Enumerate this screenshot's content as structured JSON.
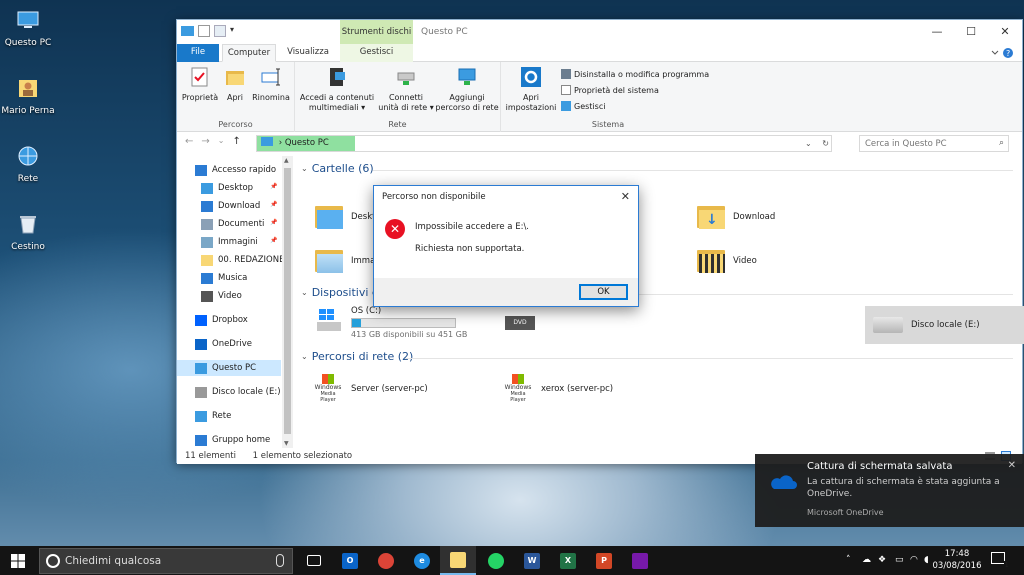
{
  "desktop": {
    "icons": [
      {
        "label": "Questo PC",
        "icon": "this-pc-icon"
      },
      {
        "label": "Mario Perna",
        "icon": "user-folder-icon"
      },
      {
        "label": "Rete",
        "icon": "network-icon"
      },
      {
        "label": "Cestino",
        "icon": "recycle-bin-icon"
      }
    ]
  },
  "explorer": {
    "title": "Questo PC",
    "context_tab_header": "Strumenti dischi",
    "tabs": {
      "file": "File",
      "computer": "Computer",
      "visualizza": "Visualizza",
      "gestisci": "Gestisci"
    },
    "ribbon": {
      "percorso": {
        "label": "Percorso",
        "buttons": [
          "Proprietà",
          "Apri",
          "Rinomina"
        ]
      },
      "rete": {
        "label": "Rete",
        "accedi": [
          "Accedi a contenuti",
          "multimediali ▾"
        ],
        "connetti": [
          "Connetti",
          "unità di rete ▾"
        ],
        "aggiungi": [
          "Aggiungi",
          "percorso di rete"
        ]
      },
      "sistema": {
        "label": "Sistema",
        "apri": [
          "Apri",
          "impostazioni"
        ],
        "small": [
          "Disinstalla o modifica programma",
          "Proprietà del sistema",
          "Gestisci"
        ]
      }
    },
    "address": {
      "crumb": "Questo PC",
      "separator": "›"
    },
    "search": {
      "placeholder": "Cerca in Questo PC"
    },
    "nav_glyphs": {
      "back": "←",
      "forward": "→",
      "dropdown": "⌄",
      "up": "↑"
    },
    "address_tools": {
      "dropdown": "⌄",
      "refresh": "↻"
    },
    "navpane": [
      {
        "label": "Accesso rapido",
        "icon": "star-icon",
        "color": "#2b7bd3"
      },
      {
        "label": "Desktop",
        "icon": "desktop-icon",
        "color": "#3b9be0",
        "pinned": true
      },
      {
        "label": "Download",
        "icon": "download-icon",
        "color": "#2b7bd3",
        "pinned": true
      },
      {
        "label": "Documenti",
        "icon": "documents-icon",
        "color": "#8aa0b6",
        "pinned": true
      },
      {
        "label": "Immagini",
        "icon": "pictures-icon",
        "color": "#7aa7c7",
        "pinned": true
      },
      {
        "label": "00. REDAZIONE",
        "icon": "folder-icon",
        "color": "#f8d775"
      },
      {
        "label": "Musica",
        "icon": "music-icon",
        "color": "#2b7bd3"
      },
      {
        "label": "Video",
        "icon": "video-icon",
        "color": "#555555"
      },
      {
        "label": "Dropbox",
        "icon": "dropbox-icon",
        "color": "#0061fe"
      },
      {
        "label": "OneDrive",
        "icon": "onedrive-icon",
        "color": "#0a64c8"
      },
      {
        "label": "Questo PC",
        "icon": "this-pc-icon",
        "color": "#3b9be0",
        "selected": true
      },
      {
        "label": "Disco locale (E:)",
        "icon": "drive-icon",
        "color": "#999999"
      },
      {
        "label": "Rete",
        "icon": "network-icon",
        "color": "#3b9be0"
      },
      {
        "label": "Gruppo home",
        "icon": "homegroup-icon",
        "color": "#2b7bd3"
      }
    ],
    "sections": {
      "cartelle": "Cartelle (6)",
      "dispositivi": "Dispositivi e unità (3)",
      "percorsi": "Percorsi di rete (2)"
    },
    "folders": [
      "Desktop",
      "Download",
      "Immagini",
      "Video"
    ],
    "drives": {
      "os": {
        "name": "OS (C:)",
        "free": "413 GB disponibili su 451 GB",
        "used_fraction": 0.085
      },
      "dvd": {
        "name": "DVD"
      },
      "e": {
        "name": "Disco locale (E:)"
      }
    },
    "network": [
      {
        "name": "Server (server-pc)",
        "badge": [
          "Windows",
          "Media Player"
        ]
      },
      {
        "name": "xerox (server-pc)",
        "badge": [
          "Windows",
          "Media Player"
        ]
      }
    ],
    "status": {
      "count": "11 elementi",
      "selection": "1 elemento selezionato"
    }
  },
  "dialog": {
    "title": "Percorso non disponibile",
    "line1": "Impossibile accedere a E:\\.",
    "line2": "Richiesta non supportata.",
    "ok": "OK"
  },
  "toast": {
    "title": "Cattura di schermata salvata",
    "message": "La cattura di schermata è stata aggiunta a OneDrive.",
    "source": "Microsoft OneDrive"
  },
  "taskbar": {
    "search_placeholder": "Chiedimi qualcosa",
    "apps": [
      {
        "name": "task-view",
        "label": "",
        "color": "#141414"
      },
      {
        "name": "outlook",
        "label": "O",
        "color": "#0a64c8"
      },
      {
        "name": "chrome",
        "label": "",
        "color": "#db4437"
      },
      {
        "name": "edge",
        "label": "e",
        "color": "#1e8be0"
      },
      {
        "name": "file-explorer",
        "label": "",
        "color": "#f8d775",
        "active": true
      },
      {
        "name": "whatsapp",
        "label": "",
        "color": "#25d366"
      },
      {
        "name": "word",
        "label": "W",
        "color": "#2b579a"
      },
      {
        "name": "excel",
        "label": "X",
        "color": "#217346"
      },
      {
        "name": "powerpoint",
        "label": "P",
        "color": "#d24726"
      },
      {
        "name": "onenote-app",
        "label": "",
        "color": "#7719aa"
      }
    ],
    "time": "17:48",
    "date": "03/08/2016",
    "notifications": "1"
  },
  "accent": "#1979ca"
}
